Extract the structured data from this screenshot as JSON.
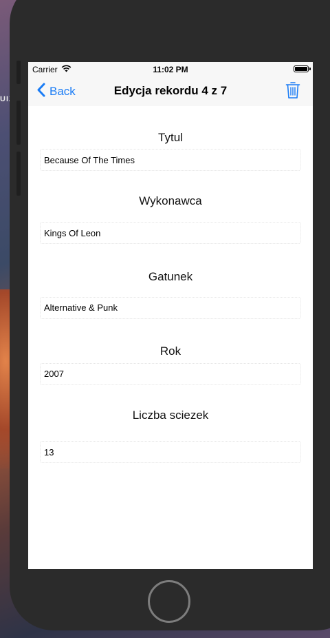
{
  "desktop": {
    "partial_label": "UIZ"
  },
  "status_bar": {
    "carrier": "Carrier",
    "time": "11:02 PM",
    "battery_level": 1.0
  },
  "nav": {
    "back_label": "Back",
    "title": "Edycja rekordu 4 z 7",
    "accent_color": "#1a7cf5"
  },
  "fields": {
    "title": {
      "label": "Tytul",
      "value": "Because Of The Times"
    },
    "artist": {
      "label": "Wykonawca",
      "value": "Kings Of Leon"
    },
    "genre": {
      "label": "Gatunek",
      "value": "Alternative & Punk"
    },
    "year": {
      "label": "Rok",
      "value": "2007"
    },
    "tracks": {
      "label": "Liczba sciezek",
      "value": "13"
    }
  },
  "icons": {
    "back": "chevron-left-icon",
    "delete": "trash-icon",
    "wifi": "wifi-icon",
    "battery": "battery-icon"
  }
}
